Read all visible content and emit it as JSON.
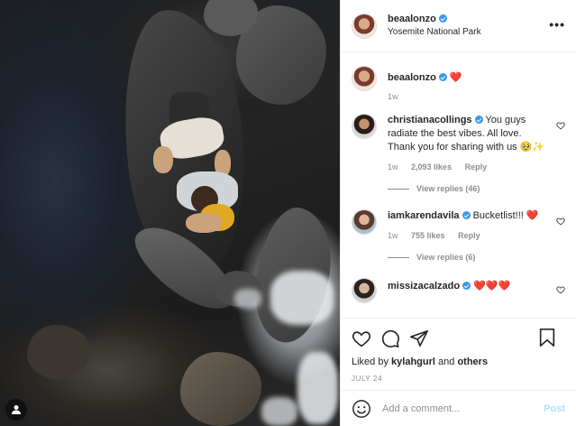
{
  "post": {
    "username": "beaalonzo",
    "location": "Yosemite National Park",
    "more_label": "•••",
    "photo_alt": "aerial view of two people sitting on a rock in a river"
  },
  "comments": [
    {
      "username": "beaalonzo",
      "text": "❤️",
      "time": "1w",
      "likes": "",
      "reply": "",
      "view_replies": "",
      "avatar": "bea"
    },
    {
      "username": "christianacollings",
      "text": "You guys radiate the best vibes. All love. Thank you for sharing with us 🥹✨",
      "time": "1w",
      "likes": "2,093 likes",
      "reply": "Reply",
      "view_replies": "View replies (46)",
      "avatar": "chr"
    },
    {
      "username": "iamkarendavila",
      "text": "Bucketlist!!! ❤️",
      "time": "1w",
      "likes": "755 likes",
      "reply": "Reply",
      "view_replies": "View replies (6)",
      "avatar": "kar"
    },
    {
      "username": "missizacalzado",
      "text": "❤️❤️❤️",
      "time": "",
      "likes": "",
      "reply": "",
      "view_replies": "",
      "avatar": "iza"
    }
  ],
  "actions": {
    "liked_prefix": "Liked by",
    "liked_user": "kylahgurl",
    "liked_and": "and",
    "liked_others": "others",
    "date": "JULY 24"
  },
  "comment_box": {
    "placeholder": "Add a comment...",
    "post_label": "Post"
  },
  "colors": {
    "verified": "#3897f0",
    "heart": "#ed4956",
    "post_disabled": "#b2dffc",
    "muted": "#8e8e8e"
  },
  "icons": [
    "verified-badge-icon",
    "heart-icon",
    "comment-icon",
    "share-icon",
    "bookmark-icon",
    "emoji-icon",
    "user-tag-icon",
    "more-options-icon"
  ]
}
